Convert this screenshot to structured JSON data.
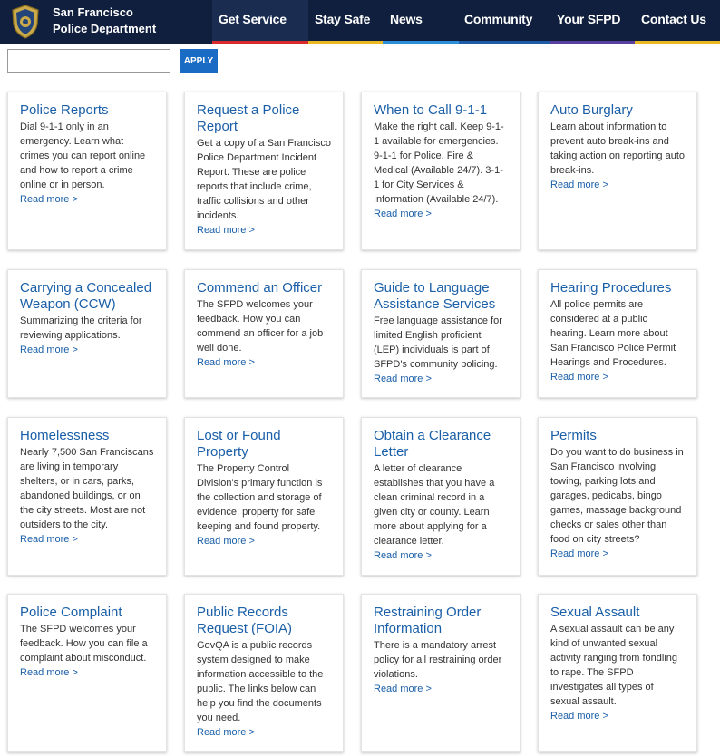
{
  "header": {
    "brand_line1": "San Francisco",
    "brand_line2": "Police Department",
    "logo_icon": "sfpd-badge-icon",
    "nav": [
      {
        "label": "Get Service",
        "stripe": "#d92b2b",
        "active": true
      },
      {
        "label": "Stay Safe",
        "stripe": "#e8b923"
      },
      {
        "label": "News",
        "stripe": "#2e8fd9"
      },
      {
        "label": "Community",
        "stripe": "#1f5ca8"
      },
      {
        "label": "Your SFPD",
        "stripe": "#5a3f9e"
      },
      {
        "label": "Contact Us",
        "stripe": "#e8b923"
      }
    ]
  },
  "search": {
    "value": "",
    "apply_label": "APPLY"
  },
  "cards": [
    {
      "title": "Police Reports",
      "desc": "Dial 9-1-1 only in an emergency. Learn what crimes you can report online and how to report a crime online or in person.",
      "link": "Read more >"
    },
    {
      "title": "Request a Police Report",
      "desc": "Get a copy of a San Francisco Police Department Incident Report. These are police reports that include crime, traffic collisions and other incidents.",
      "link": "Read more >"
    },
    {
      "title": "When to Call 9-1-1",
      "desc": "Make the right call. Keep 9-1-1 available for emergencies. 9-1-1 for Police, Fire & Medical (Available 24/7). 3-1-1 for City Services & Information (Available 24/7).",
      "link": "Read more >"
    },
    {
      "title": "Auto Burglary",
      "desc": "Learn about information to prevent auto break-ins and taking action on reporting auto break-ins.",
      "link": "Read more >"
    },
    {
      "title": "Carrying a Concealed Weapon (CCW)",
      "desc": "Summarizing the criteria for reviewing applications.",
      "link": "Read more >"
    },
    {
      "title": "Commend an Officer",
      "desc": "The SFPD welcomes your feedback. How you can commend an officer for a job well done.",
      "link": "Read more >"
    },
    {
      "title": "Guide to Language Assistance Services",
      "desc": "Free language assistance for limited English proficient (LEP) individuals is part of SFPD's community policing.",
      "link": "Read more >"
    },
    {
      "title": "Hearing Procedures",
      "desc": "All police permits are considered at a public hearing. Learn more about San Francisco Police Permit Hearings and Procedures.",
      "link": "Read more >"
    },
    {
      "title": "Homelessness",
      "desc": "Nearly 7,500 San Franciscans are living in temporary shelters, or in cars, parks, abandoned buildings, or on the city streets. Most are not outsiders to the city.",
      "link": "Read more >"
    },
    {
      "title": "Lost or Found Property",
      "desc": "The Property Control Division's primary function is the collection and storage of evidence, property for safe keeping and found property.",
      "link": "Read more >"
    },
    {
      "title": "Obtain a Clearance Letter",
      "desc": "A letter of clearance establishes that you have a clean criminal record in a given city or county. Learn more about applying for a clearance letter.",
      "link": "Read more >"
    },
    {
      "title": "Permits",
      "desc": "Do you want to do business in San Francisco involving towing, parking lots and garages, pedicabs, bingo games, massage background checks or sales other than food on city streets?",
      "link": "Read more >"
    },
    {
      "title": "Police Complaint",
      "desc": "The SFPD welcomes your feedback. How you can file a complaint about misconduct.",
      "link": "Read more >"
    },
    {
      "title": "Public Records Request (FOIA)",
      "desc": "GovQA is a public records system designed to make information accessible to the public. The links below can help you find the documents you need.",
      "link": "Read more >"
    },
    {
      "title": "Restraining Order Information",
      "desc": "There is a mandatory arrest policy for all restraining order violations.",
      "link": "Read more >"
    },
    {
      "title": "Sexual Assault",
      "desc": "A sexual assault can be any kind of unwanted sexual activity ranging from fondling to rape.  The SFPD investigates all types of sexual assault.",
      "link": "Read more >"
    }
  ]
}
